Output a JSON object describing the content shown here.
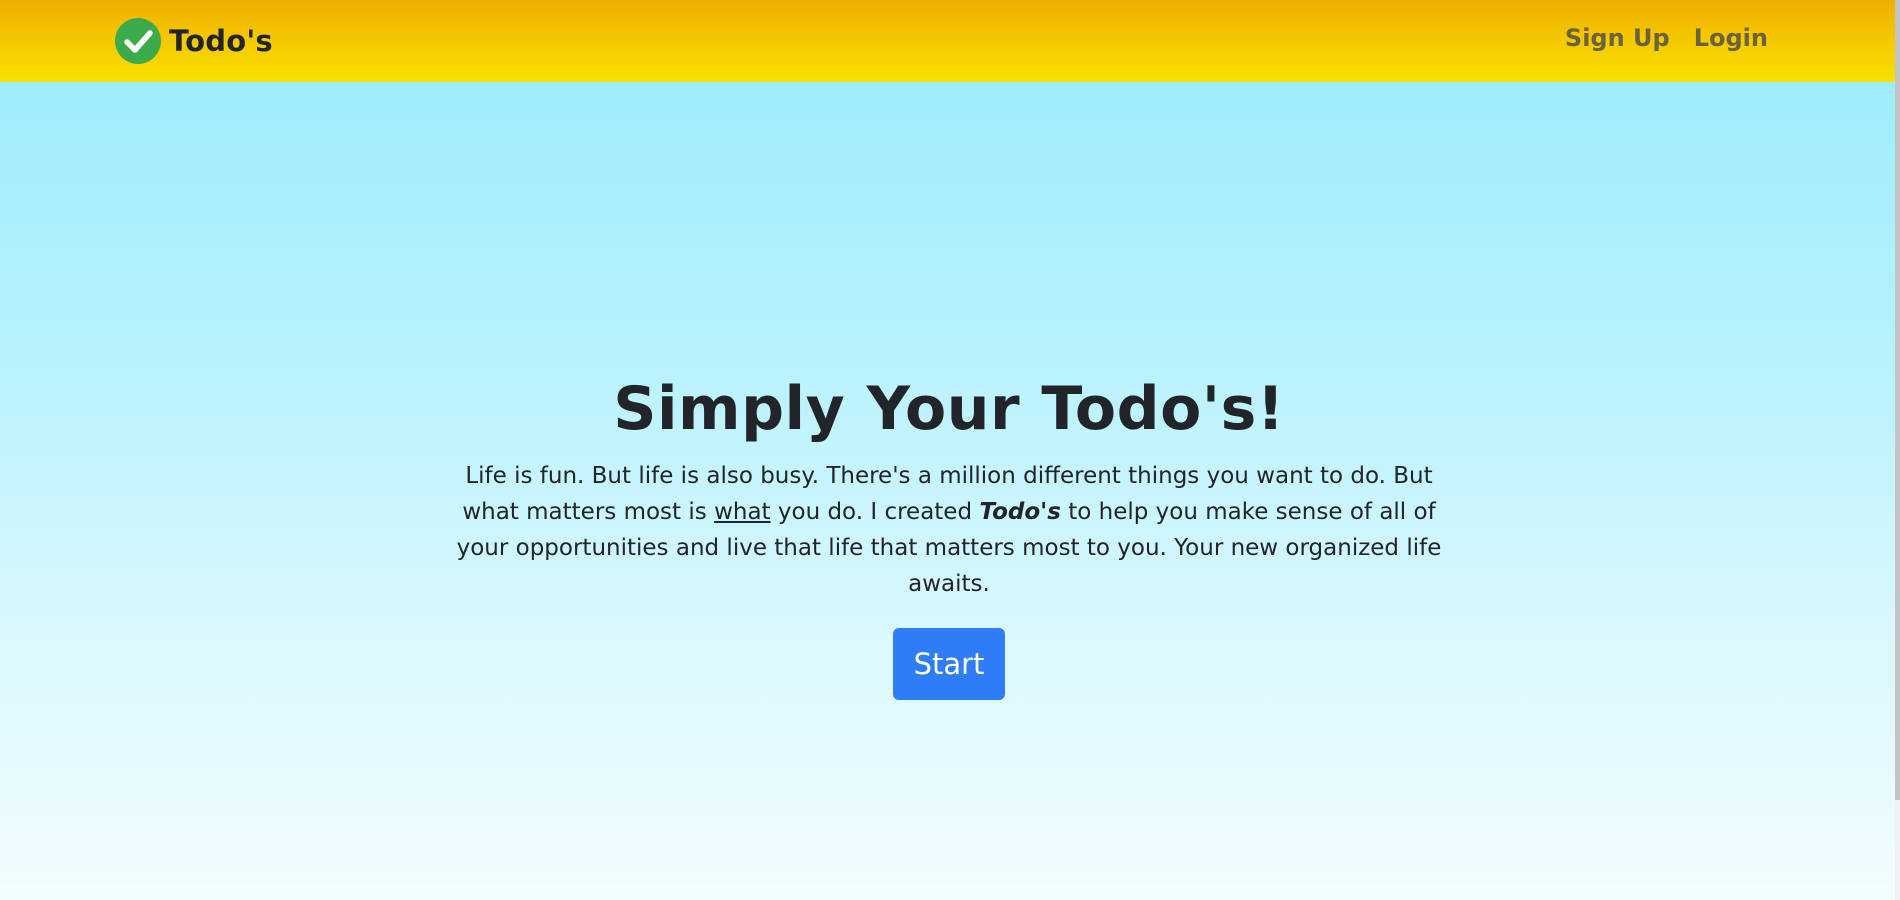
{
  "navbar": {
    "brand": "Todo's",
    "logo_icon": "check-circle-icon",
    "logo_color": "#3cab4b",
    "links": [
      {
        "label": "Sign Up"
      },
      {
        "label": "Login"
      }
    ]
  },
  "hero": {
    "title": "Simply Your Todo's!",
    "text_part1": "Life is fun. But life is also busy. There's a million different things you want to do. But what matters most is ",
    "text_underline": "what",
    "text_part2": " you do. I created ",
    "text_emphasis": "Todo's",
    "text_part3": " to help you make sense of all of your opportunities and live that life that matters most to you. Your new organized life awaits.",
    "button_label": "Start"
  },
  "colors": {
    "navbar_gradient": [
      "#f0ae00",
      "#f9e000"
    ],
    "background_gradient": [
      "#96ebfd",
      "#f2fdfe"
    ],
    "primary_button": "#2f7cf7",
    "nav_link": "#6b6338"
  }
}
